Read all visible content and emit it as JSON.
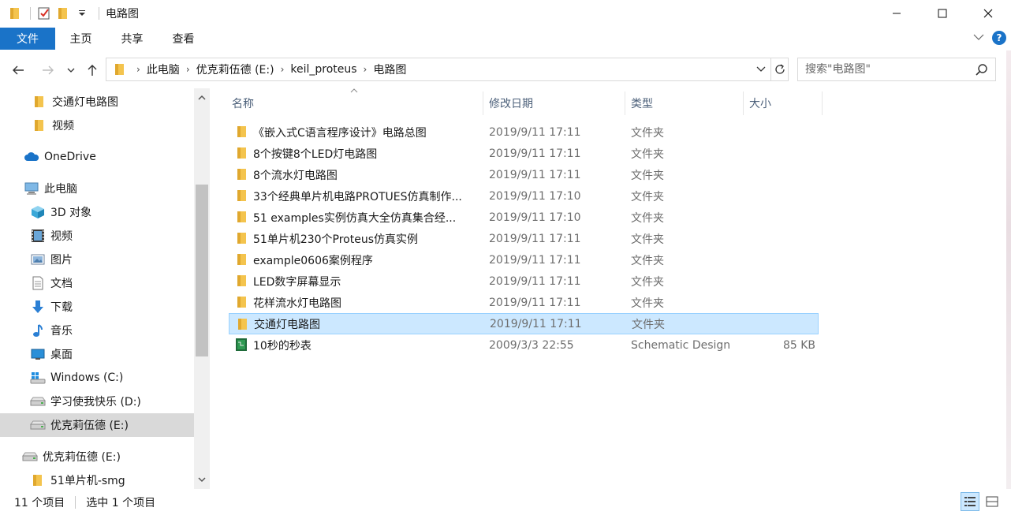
{
  "window": {
    "title": "电路图"
  },
  "ribbon": {
    "tabs": [
      "文件",
      "主页",
      "共享",
      "查看"
    ]
  },
  "address": {
    "crumbs": [
      "此电脑",
      "优克莉伍德 (E:)",
      "keil_proteus",
      "电路图"
    ]
  },
  "search": {
    "placeholder": "搜索\"电路图\""
  },
  "nav": {
    "items": [
      {
        "label": "交通灯电路图",
        "icon": "folder-icon"
      },
      {
        "label": "视频",
        "icon": "folder-icon"
      },
      {
        "label": "OneDrive",
        "icon": "cloud-icon"
      },
      {
        "label": "此电脑",
        "icon": "computer-icon"
      },
      {
        "label": "3D 对象",
        "icon": "cube-icon"
      },
      {
        "label": "视频",
        "icon": "film-icon"
      },
      {
        "label": "图片",
        "icon": "picture-icon"
      },
      {
        "label": "文档",
        "icon": "document-icon"
      },
      {
        "label": "下载",
        "icon": "download-icon"
      },
      {
        "label": "音乐",
        "icon": "music-icon"
      },
      {
        "label": "桌面",
        "icon": "desktop-icon"
      },
      {
        "label": "Windows (C:)",
        "icon": "windows-drive-icon"
      },
      {
        "label": "学习使我快乐 (D:)",
        "icon": "drive-icon"
      },
      {
        "label": "优克莉伍德 (E:)",
        "icon": "drive-icon"
      },
      {
        "label": "优克莉伍德 (E:)",
        "icon": "drive-icon"
      },
      {
        "label": "51单片机-smg",
        "icon": "folder-icon"
      }
    ]
  },
  "columns": {
    "name": "名称",
    "date": "修改日期",
    "type": "类型",
    "size": "大小"
  },
  "files": [
    {
      "name": "《嵌入式C语言程序设计》电路总图",
      "date": "2019/9/11 17:11",
      "type": "文件夹",
      "size": ""
    },
    {
      "name": "8个按键8个LED灯电路图",
      "date": "2019/9/11 17:11",
      "type": "文件夹",
      "size": ""
    },
    {
      "name": "8个流水灯电路图",
      "date": "2019/9/11 17:11",
      "type": "文件夹",
      "size": ""
    },
    {
      "name": "33个经典单片机电路PROTUES仿真制作...",
      "date": "2019/9/11 17:10",
      "type": "文件夹",
      "size": ""
    },
    {
      "name": "51 examples实例仿真大全仿真集合经...",
      "date": "2019/9/11 17:10",
      "type": "文件夹",
      "size": ""
    },
    {
      "name": "51单片机230个Proteus仿真实例",
      "date": "2019/9/11 17:11",
      "type": "文件夹",
      "size": ""
    },
    {
      "name": "example0606案例程序",
      "date": "2019/9/11 17:11",
      "type": "文件夹",
      "size": ""
    },
    {
      "name": "LED数字屏幕显示",
      "date": "2019/9/11 17:11",
      "type": "文件夹",
      "size": ""
    },
    {
      "name": "花样流水灯电路图",
      "date": "2019/9/11 17:11",
      "type": "文件夹",
      "size": ""
    },
    {
      "name": "交通灯电路图",
      "date": "2019/9/11 17:11",
      "type": "文件夹",
      "size": ""
    },
    {
      "name": "10秒的秒表",
      "date": "2009/3/3 22:55",
      "type": "Schematic Design",
      "size": "85 KB"
    }
  ],
  "status": {
    "count": "11 个项目",
    "selection": "选中 1 个项目"
  },
  "colors": {
    "accent": "#1a73c8",
    "selection": "#cce8ff",
    "folder": "#f4c44e"
  }
}
